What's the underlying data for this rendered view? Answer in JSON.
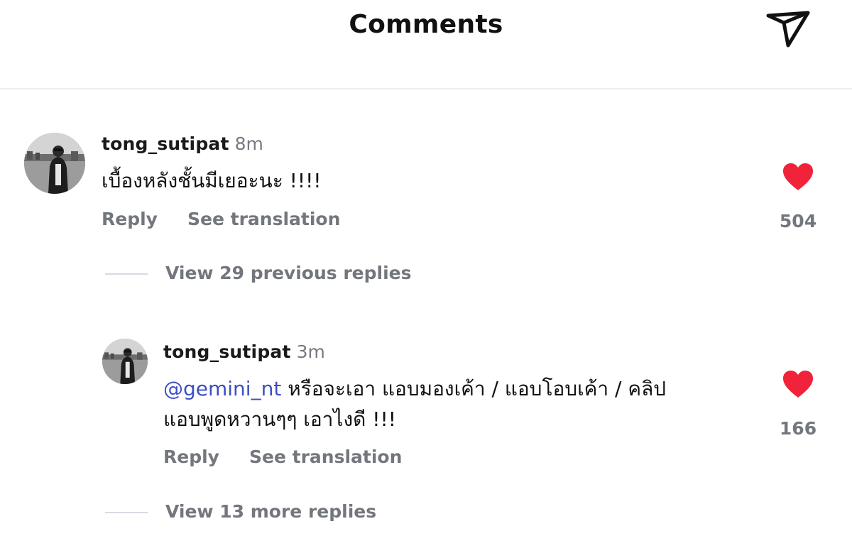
{
  "header": {
    "title": "Comments",
    "share_icon": "paper-plane-icon"
  },
  "comments": [
    {
      "username": "tong_sutipat",
      "time": "8m",
      "text": "เบื้องหลังชั้นมีเยอะนะ !!!!",
      "reply_label": "Reply",
      "translate_label": "See translation",
      "likes": "504",
      "view_replies": "View 29 previous replies"
    },
    {
      "username": "tong_sutipat",
      "time": "3m",
      "mention": "@gemini_nt",
      "text_line1": " หรือจะเอา แอบมองเค้า / แอบโอบเค้า / คลิป",
      "text_line2": "แอบพูดหวานๆๆ เอาไงดี !!!",
      "reply_label": "Reply",
      "translate_label": "See translation",
      "likes": "166",
      "view_replies": "View 13 more replies"
    }
  ],
  "colors": {
    "heart": "#f0233a",
    "mention": "#3c4fc4",
    "secondary_text": "#73777d"
  }
}
